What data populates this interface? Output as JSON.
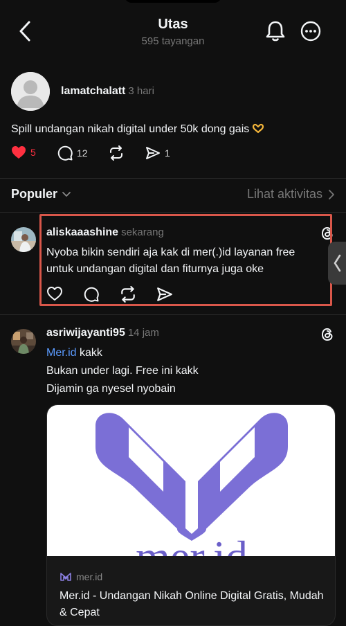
{
  "header": {
    "title": "Utas",
    "views": "595 tayangan"
  },
  "post": {
    "username": "lamatchalatt",
    "time": "3 hari",
    "text": "Spill undangan nikah digital under 50k dong gais",
    "likes": "5",
    "comments": "12",
    "shares": "1"
  },
  "sort": {
    "label": "Populer",
    "activity": "Lihat aktivitas"
  },
  "comments": [
    {
      "username": "aliskaaashine",
      "time": "sekarang",
      "text": "Nyoba bikin sendiri aja kak di mer(.)id layanan free untuk undangan digital dan fiturnya juga oke"
    },
    {
      "username": "asriwijayanti95",
      "time": "14 jam",
      "link": "Mer.id",
      "link_suffix": " kakk",
      "line2": "Bukan under lagi. Free ini kakk",
      "line3": "Dijamin ga nyesel nyobain",
      "card": {
        "logo_text": "mer.id",
        "domain": "mer.id",
        "title": "Mer.id - Undangan Nikah Online Digital Gratis, Mudah & Cepat"
      }
    }
  ],
  "colors": {
    "background": "#101010",
    "like_red": "#ff3040",
    "highlight": "#d9574a",
    "link_blue": "#5b9bff",
    "brand_purple": "#7b6fd6"
  }
}
